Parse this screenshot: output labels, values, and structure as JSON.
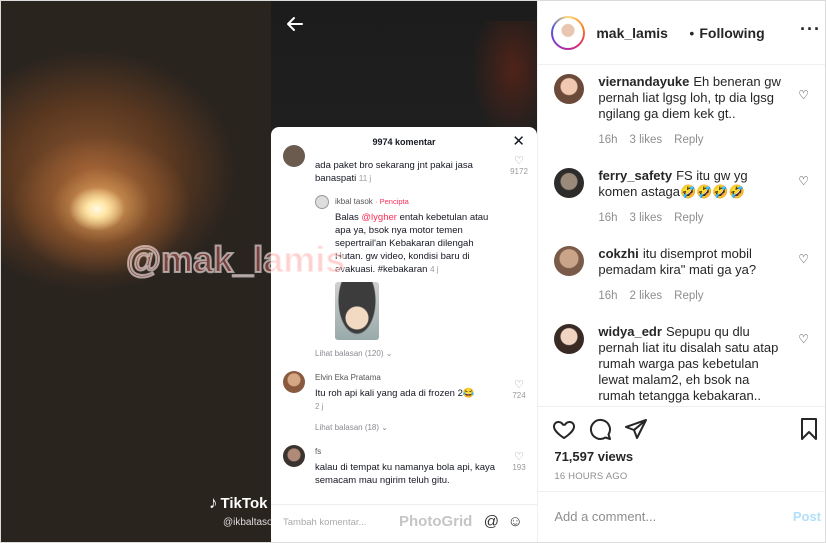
{
  "media": {
    "watermark": "@mak_lamis",
    "tiktok_logo": "TikTok",
    "tiktok_handle": "@ikbaltasok",
    "comment_sheet": {
      "count_label": "9974 komentar",
      "comments": [
        {
          "text": "ada paket bro sekarang jnt pakai jasa banaspati",
          "time": "11 j",
          "likes": "9172"
        },
        {
          "user": "ikbal tasok",
          "creator_label": "· Pencipta",
          "prefix": "Balas",
          "mention": "@lygher",
          "text": "entah kebetulan atau apa ya, bsok nya motor temen sepertrail'an Kebakaran dilengah Hutan. gw video, kondisi baru di evakuasi. #kebakaran",
          "time": "4 j",
          "replies_label": "Lihat balasan (120)"
        },
        {
          "user": "Elvin Eka Pratama",
          "text": "Itu roh api kali yang ada di frozen 2😂",
          "time": "2 j",
          "likes": "724",
          "replies_label": "Lihat balasan (18)"
        },
        {
          "user": "fs",
          "text": "kalau di tempat ku namanya bola api, kaya semacam mau ngirim teluh gitu.",
          "likes": "193"
        }
      ],
      "input_placeholder": "Tambah komentar...",
      "photogrid": "PhotoGrid"
    }
  },
  "panel": {
    "username": "mak_lamis",
    "following_label": "Following",
    "comments": [
      {
        "user": "viernandayuke",
        "text": "Eh beneran gw pernah liat lgsg loh, tp dia lgsg ngilang ga diem kek gt..",
        "time": "16h",
        "likes": "3 likes",
        "reply": "Reply"
      },
      {
        "user": "ferry_safety",
        "text": "FS itu gw yg komen astaga🤣🤣🤣🤣",
        "time": "16h",
        "likes": "3 likes",
        "reply": "Reply"
      },
      {
        "user": "cokzhi",
        "text": "itu disemprot mobil pemadam kira\" mati ga ya?",
        "time": "16h",
        "likes": "2 likes",
        "reply": "Reply"
      },
      {
        "user": "widya_edr",
        "text": "Sepupu qu dlu pernah liat itu disalah satu atap rumah warga pas kebetulan lewat malam2, eh bsok na rumah tetangga kebakaran.. Seperti",
        "time": "",
        "likes": "",
        "reply": ""
      }
    ],
    "views": "71,597 views",
    "time_ago": "16 HOURS AGO",
    "add_comment_placeholder": "Add a comment...",
    "post_label": "Post"
  },
  "colors": {
    "tiktok_accent": "#fe2c55",
    "post_button": "#b2dffc",
    "instagram_text": "#262626"
  }
}
